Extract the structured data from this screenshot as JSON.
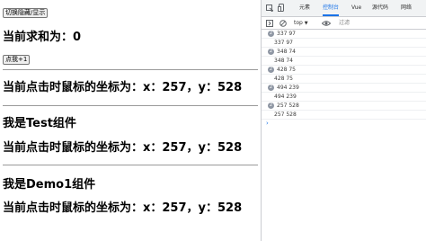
{
  "page": {
    "toggle_button": "切换隐藏/显示",
    "sum_text": "当前求和为：0",
    "add_button": "点我+1",
    "coord_app": "当前点击时鼠标的坐标为：x：257，y：528",
    "test_title": "我是Test组件",
    "coord_test": "当前点击时鼠标的坐标为：x：257，y：528",
    "demo_title": "我是Demo1组件",
    "coord_demo": "当前点击时鼠标的坐标为：x：257，y：528"
  },
  "devtools": {
    "tabs": [
      "元素",
      "控制台",
      "Vue",
      "源代码",
      "网络"
    ],
    "active_tab": "控制台",
    "context": "top",
    "filter_placeholder": "过滤",
    "logs": [
      {
        "count": "2",
        "text": "337 97"
      },
      {
        "count": "",
        "text": "337 97"
      },
      {
        "count": "2",
        "text": "348 74"
      },
      {
        "count": "",
        "text": "348 74"
      },
      {
        "count": "2",
        "text": "428 75"
      },
      {
        "count": "",
        "text": "428 75"
      },
      {
        "count": "2",
        "text": "494 239"
      },
      {
        "count": "",
        "text": "494 239"
      },
      {
        "count": "2",
        "text": "257 528"
      },
      {
        "count": "",
        "text": "257 528"
      }
    ],
    "prompt_symbol": "›"
  },
  "colors": {
    "accent": "#1a73e8",
    "badge": "#8e96a3",
    "panel_bg": "#f1f3f4",
    "border": "#cbcdd1"
  }
}
